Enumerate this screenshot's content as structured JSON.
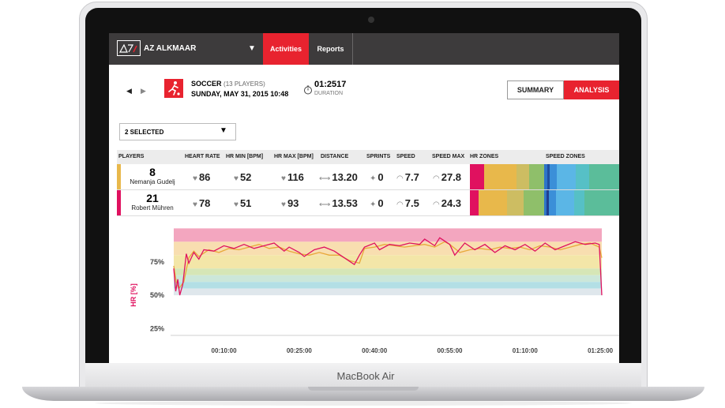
{
  "device": {
    "brand": "MacBook Air"
  },
  "header": {
    "club_name": "AZ ALKMAAR",
    "club_dropdown_icon": "caret-down-icon",
    "tabs": [
      {
        "label": "Activities",
        "active": true
      },
      {
        "label": "Reports",
        "active": false
      }
    ]
  },
  "activity": {
    "sport": "SOCCER",
    "players_count": "(13 PLAYERS)",
    "date": "SUNDAY, MAY 31, 2015 10:48",
    "duration": "01:2517",
    "duration_label": "DURATION"
  },
  "view_buttons": {
    "summary": "SUMMARY",
    "analysis": "ANALYSIS"
  },
  "selector": {
    "value": "2 SELECTED"
  },
  "table": {
    "columns": [
      "PLAYERS",
      "HEART RATE",
      "HR MIN [BPM]",
      "HR MAX [BPM]",
      "DISTANCE",
      "SPRINTS",
      "SPEED",
      "SPEED MAX",
      "HR ZONES",
      "SPEED ZONES"
    ],
    "rows": [
      {
        "number": "8",
        "name": "Nemanja Gudelj",
        "color": "#e8b84b",
        "heart_rate": "86",
        "hr_min": "52",
        "hr_max": "116",
        "distance": "13.20",
        "sprints": "0",
        "speed": "7.7",
        "speed_max": "27.8",
        "hr_zones": [
          {
            "color": "#e0115f",
            "share": 0.19
          },
          {
            "color": "#e8b84b",
            "share": 0.44
          },
          {
            "color": "#cdbd62",
            "share": 0.17
          },
          {
            "color": "#8fbf6a",
            "share": 0.2
          }
        ],
        "speed_zones": [
          {
            "color": "#2e74c9",
            "share": 0.04
          },
          {
            "color": "#1f4fa0",
            "share": 0.03
          },
          {
            "color": "#3b8fd8",
            "share": 0.1
          },
          {
            "color": "#5bb6e6",
            "share": 0.25
          },
          {
            "color": "#56c0c6",
            "share": 0.18
          },
          {
            "color": "#5bbd9a",
            "share": 0.4
          }
        ]
      },
      {
        "number": "21",
        "name": "Robert Mühren",
        "color": "#e0115f",
        "heart_rate": "78",
        "hr_min": "51",
        "hr_max": "93",
        "distance": "13.53",
        "sprints": "0",
        "speed": "7.5",
        "speed_max": "24.3",
        "hr_zones": [
          {
            "color": "#e0115f",
            "share": 0.12
          },
          {
            "color": "#e8b84b",
            "share": 0.38
          },
          {
            "color": "#cdbd62",
            "share": 0.22
          },
          {
            "color": "#8fbf6a",
            "share": 0.28
          }
        ],
        "speed_zones": [
          {
            "color": "#2e74c9",
            "share": 0.03
          },
          {
            "color": "#1f3f8f",
            "share": 0.03
          },
          {
            "color": "#3b8fd8",
            "share": 0.1
          },
          {
            "color": "#5bb6e6",
            "share": 0.24
          },
          {
            "color": "#56c0c6",
            "share": 0.14
          },
          {
            "color": "#5bbd9a",
            "share": 0.46
          }
        ]
      }
    ]
  },
  "chart_data": {
    "type": "line",
    "title": "",
    "ylabel": "HR [%]",
    "xlabel": "",
    "ylim": [
      20,
      102
    ],
    "xlim": [
      0,
      85.3
    ],
    "yticks": [
      "25%",
      "50%",
      "75%"
    ],
    "ytick_values": [
      25,
      50,
      75
    ],
    "xticks": [
      "00:10:00",
      "00:25:00",
      "00:40:00",
      "00:55:00",
      "01:10:00",
      "01:25:00"
    ],
    "xtick_values": [
      10,
      25,
      40,
      55,
      70,
      85
    ],
    "bands": [
      {
        "from": 90,
        "to": 100,
        "color": "#f3a6bf"
      },
      {
        "from": 80,
        "to": 90,
        "color": "#f8deb0"
      },
      {
        "from": 70,
        "to": 80,
        "color": "#f3e6a8"
      },
      {
        "from": 65,
        "to": 70,
        "color": "#d6e6b6"
      },
      {
        "from": 60,
        "to": 65,
        "color": "#cce7d9"
      },
      {
        "from": 55,
        "to": 60,
        "color": "#b3dfe5"
      },
      {
        "from": 50,
        "to": 55,
        "color": "#dfe7ec"
      }
    ],
    "series": [
      {
        "color": "#e8a93a",
        "points": [
          [
            0,
            72
          ],
          [
            0.5,
            60
          ],
          [
            1,
            55
          ],
          [
            2,
            60
          ],
          [
            3,
            78
          ],
          [
            4,
            83
          ],
          [
            5,
            79
          ],
          [
            7,
            84
          ],
          [
            9,
            82
          ],
          [
            11,
            85
          ],
          [
            13,
            84
          ],
          [
            15,
            86
          ],
          [
            17,
            88
          ],
          [
            19,
            85
          ],
          [
            21,
            86
          ],
          [
            23,
            83
          ],
          [
            25,
            81
          ],
          [
            27,
            80
          ],
          [
            29,
            82
          ],
          [
            31,
            80
          ],
          [
            33,
            80
          ],
          [
            35,
            76
          ],
          [
            37,
            74
          ],
          [
            38,
            85
          ],
          [
            40,
            86
          ],
          [
            42,
            88
          ],
          [
            44,
            87
          ],
          [
            46,
            86
          ],
          [
            48,
            87
          ],
          [
            50,
            88
          ],
          [
            52,
            86
          ],
          [
            54,
            90
          ],
          [
            55,
            88
          ],
          [
            57,
            82
          ],
          [
            59,
            84
          ],
          [
            61,
            85
          ],
          [
            63,
            84
          ],
          [
            65,
            86
          ],
          [
            67,
            85
          ],
          [
            69,
            86
          ],
          [
            71,
            84
          ],
          [
            73,
            87
          ],
          [
            75,
            86
          ],
          [
            77,
            84
          ],
          [
            79,
            86
          ],
          [
            81,
            88
          ],
          [
            83,
            89
          ],
          [
            84.8,
            86
          ],
          [
            85.3,
            78
          ]
        ]
      },
      {
        "color": "#e0115f",
        "points": [
          [
            0,
            70
          ],
          [
            0.4,
            53
          ],
          [
            0.8,
            62
          ],
          [
            1.2,
            50
          ],
          [
            1.8,
            58
          ],
          [
            2.5,
            81
          ],
          [
            3,
            74
          ],
          [
            4,
            82
          ],
          [
            5,
            77
          ],
          [
            6,
            84
          ],
          [
            8,
            83
          ],
          [
            10,
            87
          ],
          [
            12,
            85
          ],
          [
            14,
            88
          ],
          [
            16,
            85
          ],
          [
            18,
            87
          ],
          [
            20,
            89
          ],
          [
            22,
            83
          ],
          [
            23,
            86
          ],
          [
            25,
            82
          ],
          [
            26,
            79
          ],
          [
            28,
            84
          ],
          [
            30,
            86
          ],
          [
            32,
            83
          ],
          [
            34,
            78
          ],
          [
            36,
            73
          ],
          [
            37,
            80
          ],
          [
            38,
            86
          ],
          [
            40,
            89
          ],
          [
            41,
            84
          ],
          [
            43,
            88
          ],
          [
            45,
            87
          ],
          [
            47,
            89
          ],
          [
            49,
            88
          ],
          [
            50,
            92
          ],
          [
            52,
            87
          ],
          [
            53,
            93
          ],
          [
            55,
            88
          ],
          [
            56,
            80
          ],
          [
            58,
            89
          ],
          [
            60,
            84
          ],
          [
            62,
            88
          ],
          [
            64,
            82
          ],
          [
            66,
            87
          ],
          [
            68,
            84
          ],
          [
            70,
            88
          ],
          [
            72,
            83
          ],
          [
            74,
            89
          ],
          [
            76,
            84
          ],
          [
            78,
            87
          ],
          [
            80,
            90
          ],
          [
            82,
            88
          ],
          [
            84,
            89
          ],
          [
            84.8,
            88
          ],
          [
            85.3,
            50
          ]
        ]
      }
    ]
  }
}
